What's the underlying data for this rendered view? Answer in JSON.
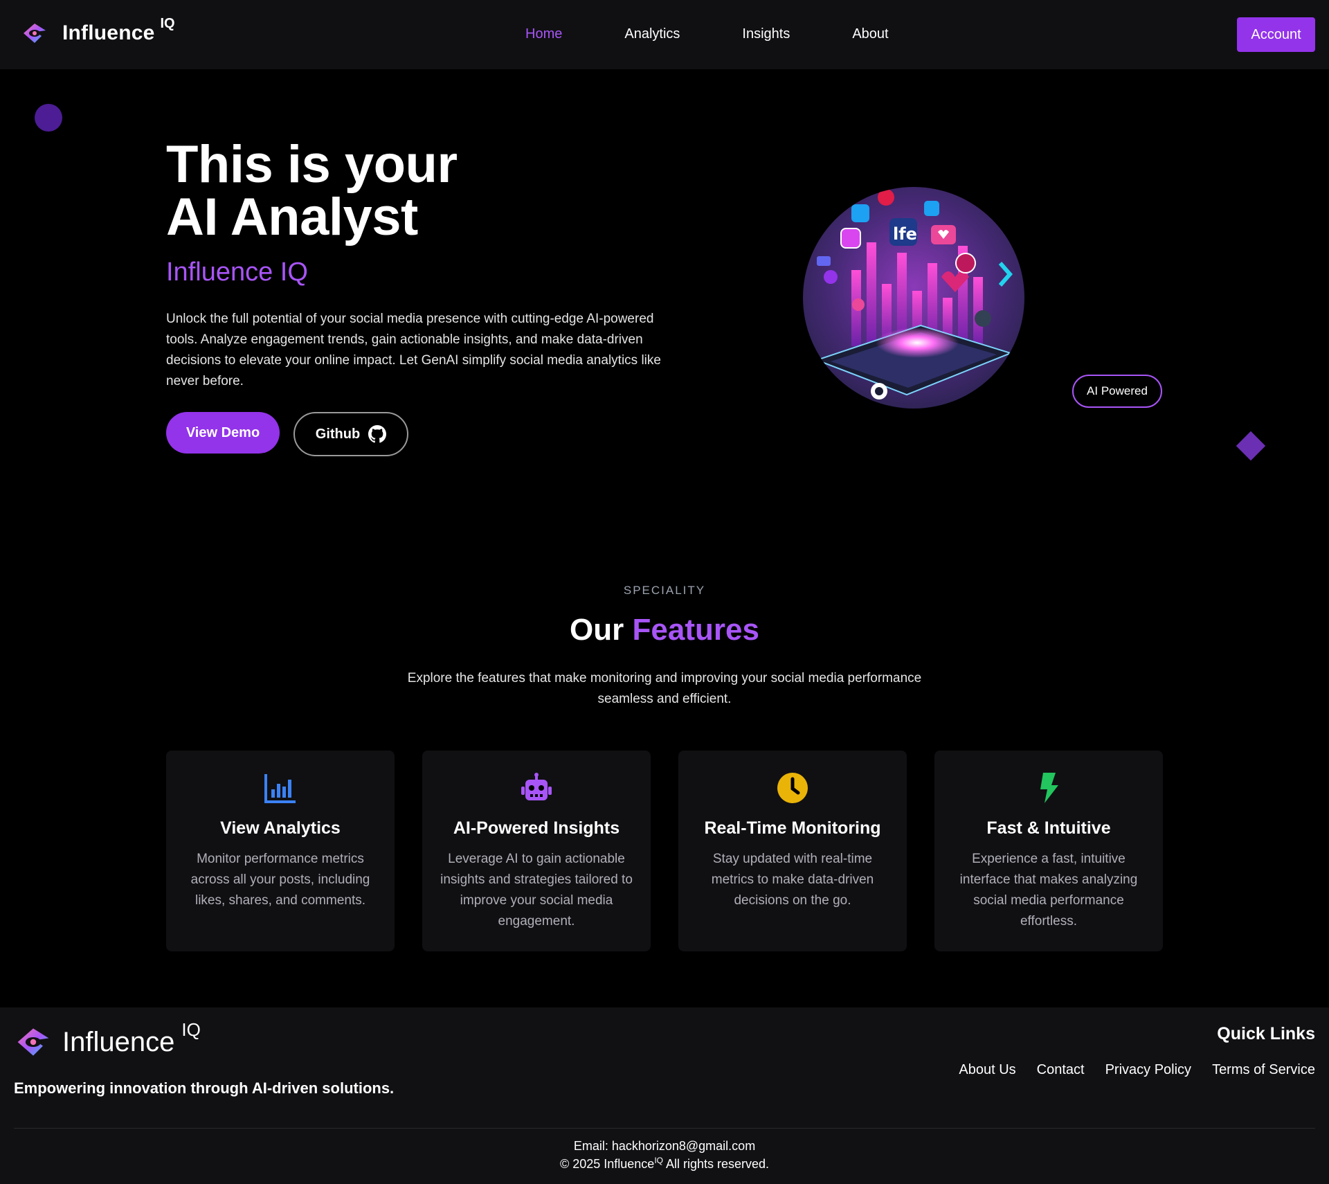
{
  "nav": {
    "brand": "Influence",
    "brand_sup": "IQ",
    "links": [
      "Home",
      "Analytics",
      "Insights",
      "About"
    ],
    "account": "Account"
  },
  "hero": {
    "title_line1": "This is your",
    "title_line2": "AI Analyst",
    "subtitle": "Influence IQ",
    "description": "Unlock the full potential of your social media presence with cutting-edge AI-powered tools. Analyze engagement trends, gain actionable insights, and make data-driven decisions to elevate your online impact. Let GenAI simplify social media analytics like never before.",
    "demo_button": "View Demo",
    "github_button": "Github",
    "badge": "AI Powered"
  },
  "features": {
    "label": "SPECIALITY",
    "title_plain": "Our",
    "title_accent": "Features",
    "description": "Explore the features that make monitoring and improving your social media performance seamless and efficient.",
    "cards": [
      {
        "icon": "bar-chart-icon",
        "title": "View Analytics",
        "desc": "Monitor performance metrics across all your posts, including likes, shares, and comments.",
        "color": "#3b82f6"
      },
      {
        "icon": "robot-icon",
        "title": "AI-Powered Insights",
        "desc": "Leverage AI to gain actionable insights and strategies tailored to improve your social media engagement.",
        "color": "#a855f7"
      },
      {
        "icon": "clock-icon",
        "title": "Real-Time Monitoring",
        "desc": "Stay updated with real-time metrics to make data-driven decisions on the go.",
        "color": "#eab308"
      },
      {
        "icon": "bolt-icon",
        "title": "Fast & Intuitive",
        "desc": "Experience a fast, intuitive interface that makes analyzing social media performance effortless.",
        "color": "#22c55e"
      }
    ]
  },
  "footer": {
    "brand": "Influence",
    "brand_sup": "IQ",
    "tagline": "Empowering innovation through AI-driven solutions.",
    "quick_links_title": "Quick Links",
    "links": [
      "About Us",
      "Contact",
      "Privacy Policy",
      "Terms of Service"
    ],
    "email": "Email: hackhorizon8@gmail.com",
    "copyright_pre": "© 2025 Influence",
    "copyright_sup": "IQ",
    "copyright_post": " All rights reserved."
  },
  "colors": {
    "accent": "#a855f7",
    "button": "#9333ea",
    "background": "#000000",
    "panel": "#101013"
  }
}
